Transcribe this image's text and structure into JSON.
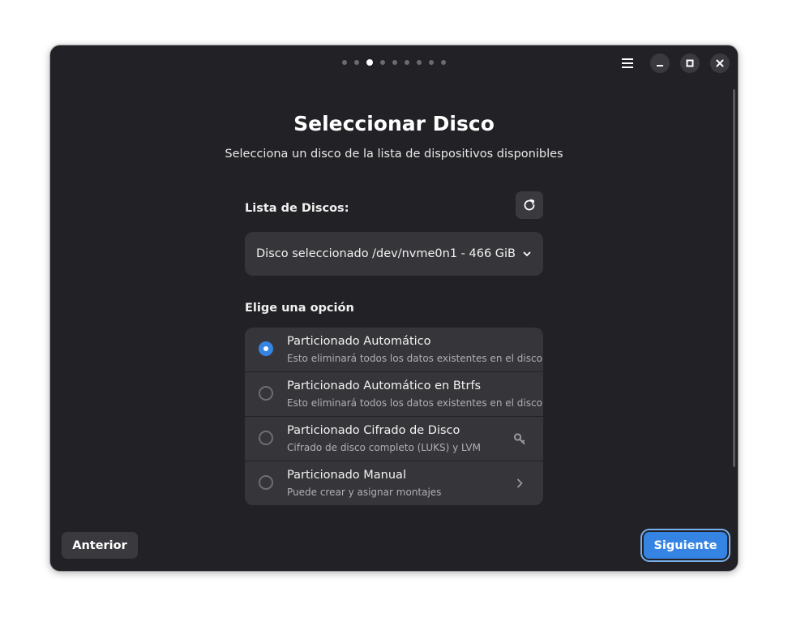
{
  "window": {
    "step_count": 9,
    "active_step": 2
  },
  "header": {
    "menu_icon": "hamburger-menu-icon",
    "minimize_icon": "minimize-icon",
    "maximize_icon": "maximize-icon",
    "close_icon": "close-icon"
  },
  "page": {
    "title": "Seleccionar Disco",
    "subtitle": "Selecciona un disco de la lista de dispositivos disponibles"
  },
  "disk_list": {
    "label": "Lista de Discos:",
    "refresh_icon": "refresh-icon",
    "selected_label": "Disco seleccionado",
    "selected_value": "/dev/nvme0n1 - 466 GiB",
    "dropdown_icon": "chevron-down-icon"
  },
  "options": {
    "label": "Elige una opción",
    "items": [
      {
        "title": "Particionado Automático",
        "description": "Esto eliminará todos los datos existentes en el disco",
        "checked": true,
        "suffix_icon": ""
      },
      {
        "title": "Particionado Automático en Btrfs",
        "description": "Esto eliminará todos los datos existentes en el disco",
        "checked": false,
        "suffix_icon": ""
      },
      {
        "title": "Particionado Cifrado de Disco",
        "description": "Cifrado de disco completo (LUKS) y LVM",
        "checked": false,
        "suffix_icon": "key-icon"
      },
      {
        "title": "Particionado Manual",
        "description": "Puede crear y asignar montajes",
        "checked": false,
        "suffix_icon": "chevron-right-icon"
      }
    ]
  },
  "footer": {
    "prev_label": "Anterior",
    "next_label": "Siguiente"
  },
  "colors": {
    "window_bg": "#222226",
    "card_bg": "#36363a",
    "accent": "#3584e4"
  }
}
